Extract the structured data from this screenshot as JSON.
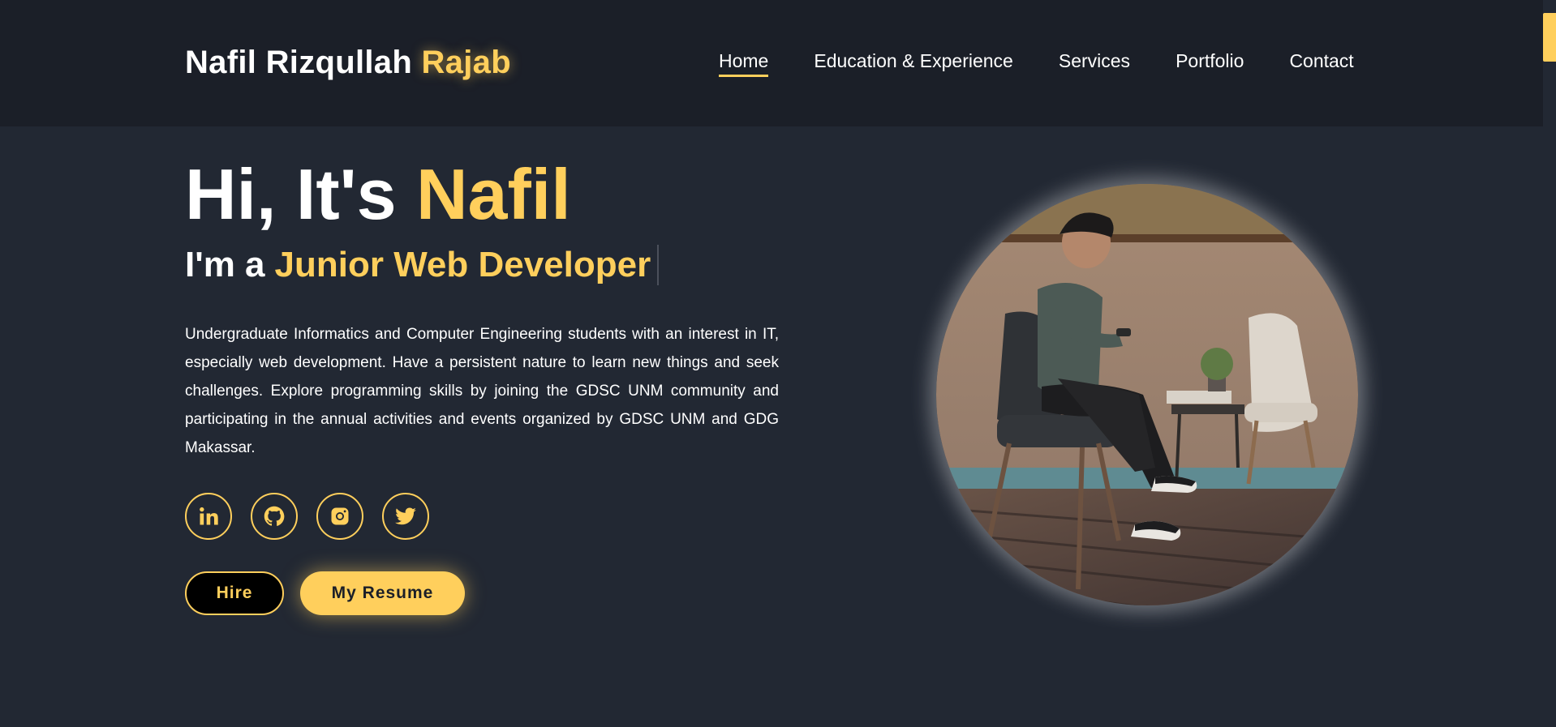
{
  "brand": {
    "first": "Nafil Rizqullah",
    "last": "Rajab"
  },
  "nav": {
    "items": [
      {
        "label": "Home",
        "active": true
      },
      {
        "label": "Education & Experience",
        "active": false
      },
      {
        "label": "Services",
        "active": false
      },
      {
        "label": "Portfolio",
        "active": false
      },
      {
        "label": "Contact",
        "active": false
      }
    ]
  },
  "hero": {
    "greeting": "Hi, It's",
    "name": "Nafil",
    "role_prefix": "I'm a",
    "role": "Junior Web Developer",
    "about": "Undergraduate Informatics and Computer Engineering students with an interest in IT, especially web development. Have a persistent nature to learn new things and seek challenges. Explore programming skills by joining the GDSC UNM community and participating in the annual activities and events organized by GDSC UNM and GDG Makassar."
  },
  "socials": [
    {
      "icon": "linkedin-icon"
    },
    {
      "icon": "github-icon"
    },
    {
      "icon": "instagram-icon"
    },
    {
      "icon": "twitter-icon"
    }
  ],
  "buttons": {
    "hire": "Hire",
    "resume": "My Resume"
  },
  "colors": {
    "accent": "#ffcf5c",
    "header_bg": "#1b1f28",
    "page_bg": "#222833"
  }
}
